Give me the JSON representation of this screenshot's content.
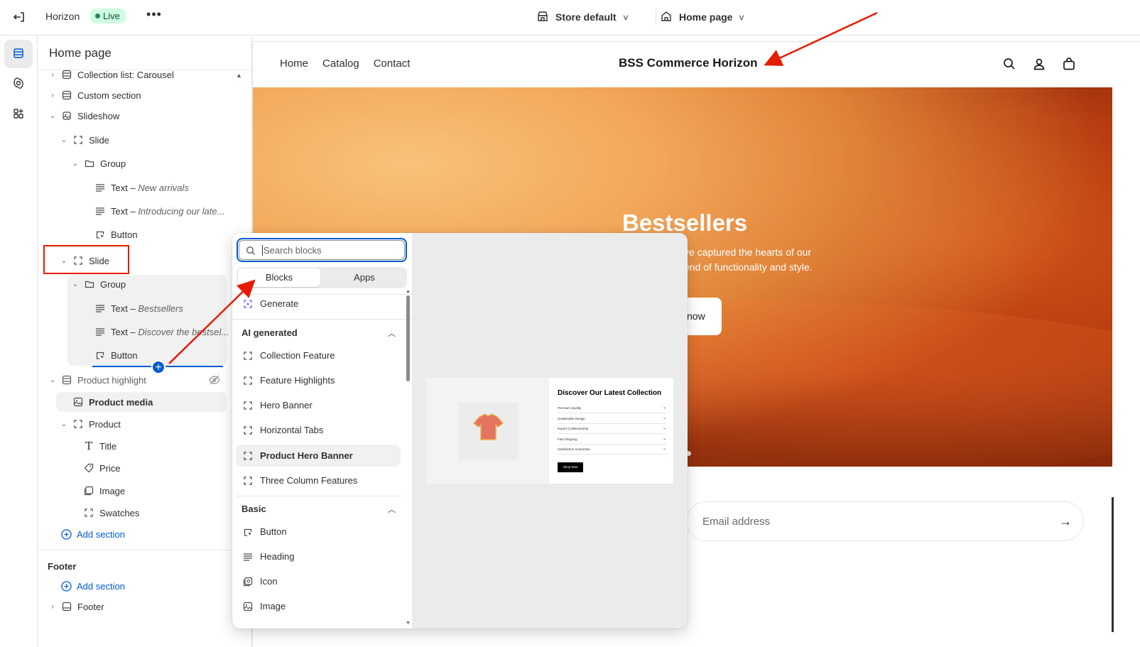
{
  "topbar": {
    "app_title": "Horizon",
    "status_badge": "Live",
    "more_label": "•••",
    "store_selector": "Store default",
    "page_selector": "Home page"
  },
  "sidebar": {
    "title": "Home page",
    "tree": [
      {
        "label": "Collection list: Carousel",
        "icon": "section-icon"
      },
      {
        "label": "Custom section",
        "icon": "section-icon"
      },
      {
        "label": "Slideshow",
        "icon": "slideshow-icon"
      },
      {
        "label": "Slide",
        "icon": "block-icon"
      },
      {
        "label": "Group",
        "icon": "folder-icon"
      },
      {
        "label": "Text",
        "detail": "New arrivals",
        "icon": "text-icon"
      },
      {
        "label": "Text",
        "detail": "Introducing our late...",
        "icon": "text-icon"
      },
      {
        "label": "Button",
        "icon": "button-icon"
      },
      {
        "label": "Slide",
        "icon": "block-icon"
      },
      {
        "label": "Group",
        "icon": "folder-icon"
      },
      {
        "label": "Text",
        "detail": "Bestsellers",
        "icon": "text-icon"
      },
      {
        "label": "Text",
        "detail": "Discover the bestsel...",
        "icon": "text-icon"
      },
      {
        "label": "Button",
        "icon": "button-icon"
      },
      {
        "label": "Product highlight",
        "icon": "section-icon"
      },
      {
        "label": "Product media",
        "icon": "media-icon"
      },
      {
        "label": "Product",
        "icon": "block-icon"
      },
      {
        "label": "Title",
        "icon": "title-icon"
      },
      {
        "label": "Price",
        "icon": "price-tag-icon"
      },
      {
        "label": "Image",
        "icon": "image-icon"
      },
      {
        "label": "Swatches",
        "icon": "block-icon"
      }
    ],
    "add_section_label": "Add section",
    "footer_group_label": "Footer",
    "footer_add_section_label": "Add section",
    "footer_item_label": "Footer",
    "text_separator": " – "
  },
  "picker": {
    "search_placeholder": "Search blocks",
    "tabs": [
      "Blocks",
      "Apps"
    ],
    "generate_label": "Generate",
    "ai_group_label": "AI generated",
    "ai_items": [
      "Collection Feature",
      "Feature Highlights",
      "Hero Banner",
      "Horizontal Tabs",
      "Product Hero Banner",
      "Three Column Features"
    ],
    "basic_group_label": "Basic",
    "basic_items": [
      "Button",
      "Heading",
      "Icon",
      "Image"
    ],
    "preview_card": {
      "title": "Discover Our Latest Collection",
      "rows": [
        "Premium Quality",
        "Sustainable Design",
        "Expert Craftsmanship",
        "Fast Shipping",
        "Satisfaction Guarantee"
      ],
      "button": "Shop Now"
    }
  },
  "storefront": {
    "nav": [
      "Home",
      "Catalog",
      "Contact"
    ],
    "brand": "BSS Commerce Horizon",
    "hero_title": "Bestsellers",
    "hero_text_line1": "ve captured the hearts of our",
    "hero_text_line2": "end of functionality and style.",
    "hero_button": "now",
    "email_placeholder": "Email address"
  },
  "colors": {
    "accent": "#005bd3",
    "live_badge_bg": "#cdfee1",
    "annotation_red": "#e51c00"
  }
}
